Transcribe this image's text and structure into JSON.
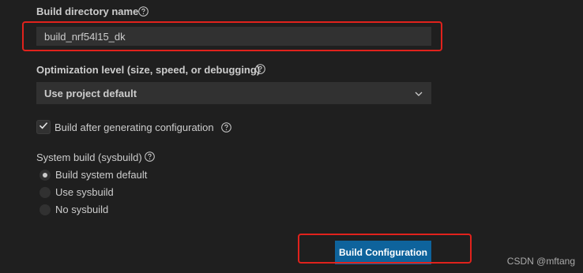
{
  "build_directory": {
    "label": "Build directory name",
    "value": "build_nrf54l15_dk",
    "help_icon": "help-circle-icon"
  },
  "optimization": {
    "label": "Optimization level (size, speed, or debugging)",
    "selected": "Use project default",
    "help_icon": "help-circle-icon",
    "dropdown_icon": "chevron-down-icon"
  },
  "build_after": {
    "label": "Build after generating configuration",
    "checked": true,
    "help_icon": "help-circle-icon"
  },
  "sysbuild": {
    "label": "System build (sysbuild)",
    "help_icon": "help-circle-icon",
    "options": [
      {
        "label": "Build system default",
        "selected": true
      },
      {
        "label": "Use sysbuild",
        "selected": false
      },
      {
        "label": "No sysbuild",
        "selected": false
      }
    ]
  },
  "actions": {
    "build_configuration_label": "Build Configuration"
  },
  "annotations": {
    "highlight_color": "#e0221c"
  },
  "watermark": {
    "text": "CSDN @mftang"
  },
  "colors": {
    "background": "#1f1f1f",
    "input_background": "#313131",
    "primary_button": "#0e639c",
    "text": "#cccccc"
  }
}
